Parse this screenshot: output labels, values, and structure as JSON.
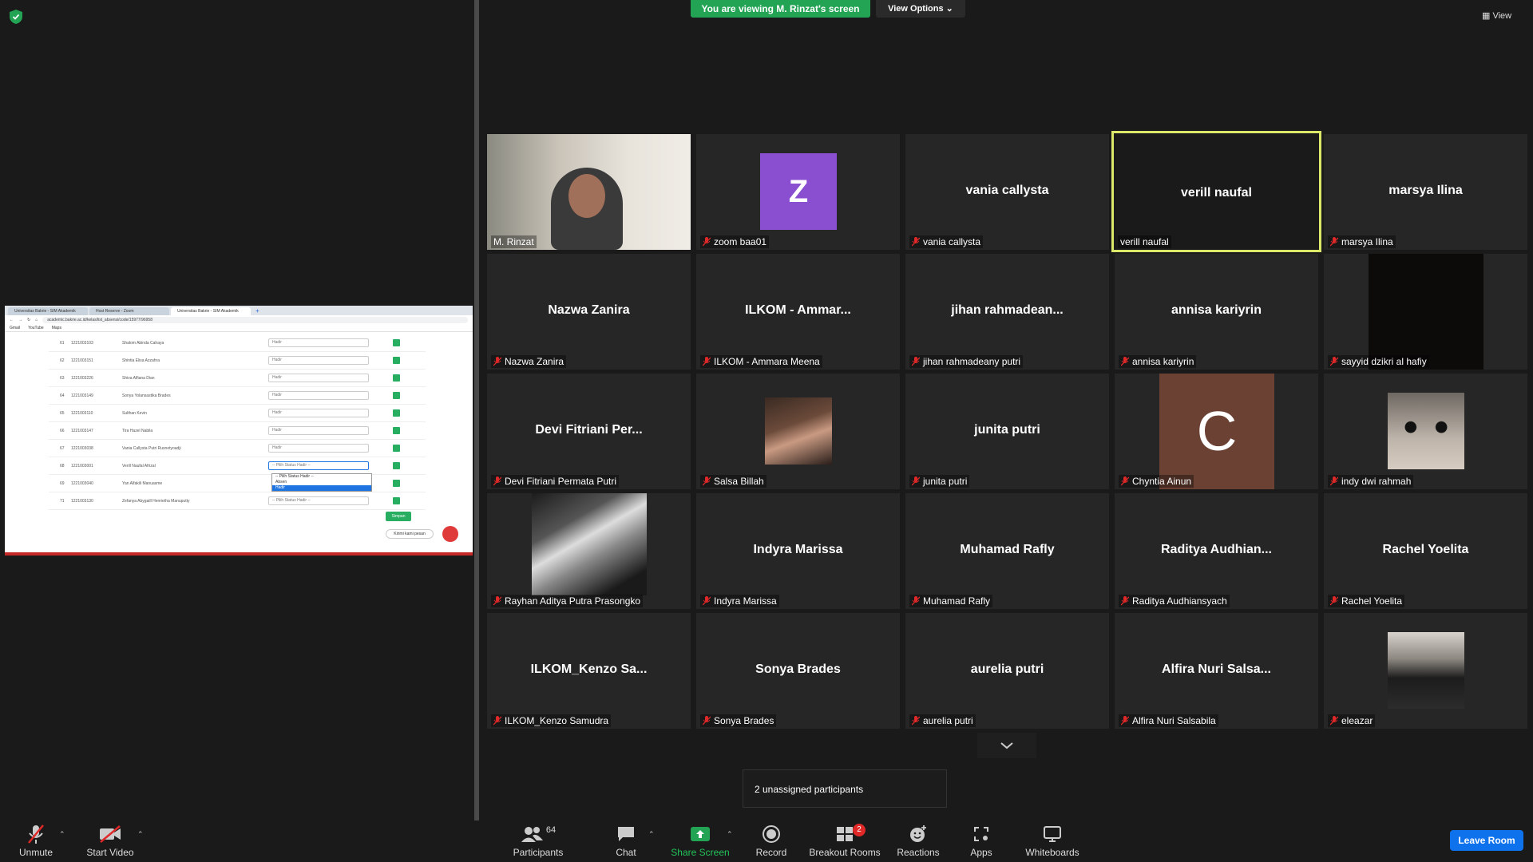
{
  "banner": {
    "viewing": "You are viewing M. Rinzat's screen",
    "view_options": "View Options"
  },
  "view_button": "View",
  "shared_screen": {
    "tabs": [
      "Universitas Bakrie - SIM Akademik",
      "Host Reserve - Zoom",
      "Universitas Bakrie - SIM Akademik"
    ],
    "url": "academic.bakrie.ac.id/kelas/list_absensi/code/15977/96958",
    "bookmarks": [
      "Gmail",
      "YouTube",
      "Maps"
    ],
    "rows": [
      {
        "no": "61",
        "nim": "1221003103",
        "name": "Shalom Abinda Cahaya",
        "status": "Hadir"
      },
      {
        "no": "62",
        "nim": "1221003151",
        "name": "Shintia Elisa Azzahra",
        "status": "Hadir"
      },
      {
        "no": "63",
        "nim": "1221003226",
        "name": "Shiva Alfiana Dian",
        "status": "Hadir"
      },
      {
        "no": "64",
        "nim": "1221003149",
        "name": "Sonya Yolansastika Brades",
        "status": "Hadir"
      },
      {
        "no": "65",
        "nim": "1221003110",
        "name": "Sulthan Kevin",
        "status": "Hadir"
      },
      {
        "no": "66",
        "nim": "1221003147",
        "name": "Tira Hazel Nabila",
        "status": "Hadir"
      },
      {
        "no": "67",
        "nim": "1221003038",
        "name": "Vania Callysta Putri Rusnetyoadji",
        "status": "Hadir"
      },
      {
        "no": "68",
        "nim": "1221003001",
        "name": "Verill Naufal Afrizal",
        "status": "-- Pilih Status Hadir --"
      },
      {
        "no": "69",
        "nim": "1221003040",
        "name": "Yan Alfakili Manuasme",
        "status": ""
      },
      {
        "no": "71",
        "nim": "1221003130",
        "name": "Zefanya Abygaill Henrietha Manuputty",
        "status": "-- Pilih Status Hadir --"
      }
    ],
    "dropdown": [
      "-- Pilih Status Hadir --",
      "Absen",
      "Hadir"
    ],
    "save_label": "Simpan",
    "chat_label": "Kirimi kami pesan"
  },
  "participants": [
    {
      "name": "M. Rinzat",
      "big": "",
      "muted": false
    },
    {
      "name": "zoom baa01",
      "big": "",
      "muted": true
    },
    {
      "name": "vania callysta",
      "big": "vania callysta",
      "muted": true
    },
    {
      "name": "verill naufal",
      "big": "verill naufal",
      "muted": false
    },
    {
      "name": "marsya Ilina",
      "big": "marsya Ilina",
      "muted": true
    },
    {
      "name": "Nazwa Zanira",
      "big": "Nazwa Zanira",
      "muted": true
    },
    {
      "name": "ILKOM - Ammara Meena",
      "big": "ILKOM  -  Ammar...",
      "muted": true
    },
    {
      "name": "jihan rahmadeany putri",
      "big": "jihan  rahmadean...",
      "muted": true
    },
    {
      "name": "annisa kariyrin",
      "big": "annisa kariyrin",
      "muted": true
    },
    {
      "name": "sayyid dzikri al hafiy",
      "big": "",
      "muted": true
    },
    {
      "name": "Devi Fitriani Permata Putri",
      "big": "Devi  Fitriani  Per...",
      "muted": true
    },
    {
      "name": "Salsa Billah",
      "big": "",
      "muted": true
    },
    {
      "name": "junita putri",
      "big": "junita putri",
      "muted": true
    },
    {
      "name": "Chyntia Ainun",
      "big": "",
      "muted": true
    },
    {
      "name": "indy dwi rahmah",
      "big": "",
      "muted": true
    },
    {
      "name": "Rayhan Aditya Putra Prasongko",
      "big": "",
      "muted": true
    },
    {
      "name": "Indyra Marissa",
      "big": "Indyra Marissa",
      "muted": true
    },
    {
      "name": "Muhamad Rafly",
      "big": "Muhamad Rafly",
      "muted": true
    },
    {
      "name": "Raditya Audhiansyach",
      "big": "Raditya  Audhian...",
      "muted": true
    },
    {
      "name": "Rachel Yoelita",
      "big": "Rachel Yoelita",
      "muted": true
    },
    {
      "name": "ILKOM_Kenzo Samudra",
      "big": "ILKOM_Kenzo  Sa...",
      "muted": true
    },
    {
      "name": "Sonya Brades",
      "big": "Sonya Brades",
      "muted": true
    },
    {
      "name": "aurelia putri",
      "big": "aurelia putri",
      "muted": true
    },
    {
      "name": "Alfira Nuri Salsabila",
      "big": "Alfira  Nuri  Salsa...",
      "muted": true
    },
    {
      "name": "eleazar",
      "big": "",
      "muted": true
    }
  ],
  "avatars": {
    "zoom_letter": "Z",
    "chyntia_letter": "C"
  },
  "unassigned": "2 unassigned participants",
  "toolbar": {
    "unmute": "Unmute",
    "start_video": "Start Video",
    "participants": "Participants",
    "participants_count": "64",
    "chat": "Chat",
    "share_screen": "Share Screen",
    "record": "Record",
    "breakout_rooms": "Breakout Rooms",
    "breakout_badge": "2",
    "reactions": "Reactions",
    "apps": "Apps",
    "whiteboards": "Whiteboards",
    "leave_room": "Leave Room"
  },
  "colors": {
    "active_speaker": "#dce86a",
    "share_green": "#23a455",
    "leave_blue": "#0e72ed",
    "mute_red": "#e02828",
    "zoom_avatar": "#8a4fd1",
    "chyntia_avatar": "#6b4134"
  }
}
